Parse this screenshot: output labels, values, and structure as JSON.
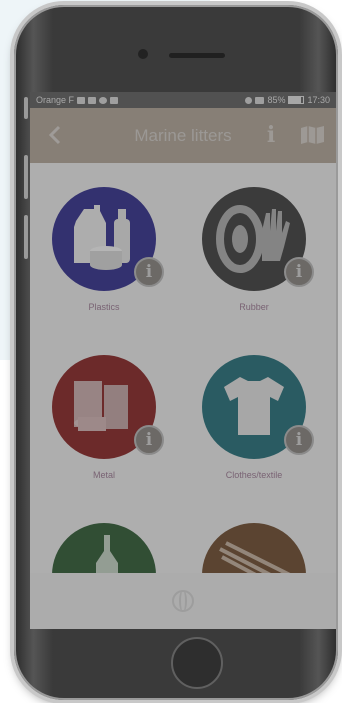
{
  "status_bar": {
    "carrier": "Orange F",
    "battery": "85%",
    "time": "17:30"
  },
  "app_bar": {
    "title": "Marine litters",
    "info_label": "i",
    "back_icon": "chevron-left-icon",
    "map_icon": "map-icon"
  },
  "categories": [
    {
      "label": "Plastics",
      "color": "#2e2a8f",
      "icon": "plastic-bottles-icon"
    },
    {
      "label": "Rubber",
      "color": "#3a3a3a",
      "icon": "tire-glove-icon"
    },
    {
      "label": "Metal",
      "color": "#8a2020",
      "icon": "cans-icon"
    },
    {
      "label": "Clothes/textile",
      "color": "#1f6f7a",
      "icon": "tshirt-icon"
    },
    {
      "label": "",
      "color": "#2a5a30",
      "icon": "glass-bottle-icon"
    },
    {
      "label": "",
      "color": "#6e4a2a",
      "icon": "wood-icon"
    }
  ],
  "info_badge": "i",
  "bottom_bar": {
    "icon": "globe-icon"
  },
  "colors": {
    "app_bar": "#b5a899",
    "label_text": "#9e7a95",
    "overlay": "rgba(60,60,60,0.38)"
  }
}
